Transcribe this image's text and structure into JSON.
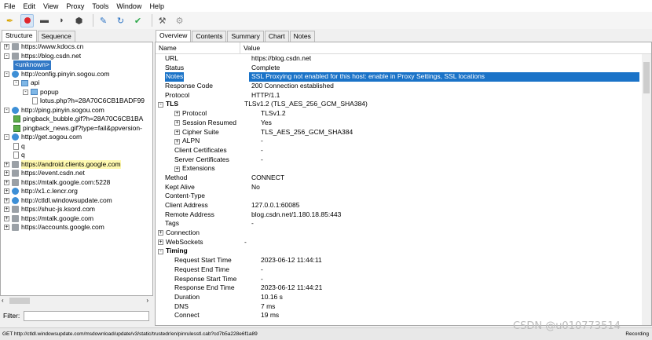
{
  "menu": [
    "File",
    "Edit",
    "View",
    "Proxy",
    "Tools",
    "Window",
    "Help"
  ],
  "left_tabs": [
    "Structure",
    "Sequence"
  ],
  "tree": [
    {
      "text": "https://www.kdocs.cn",
      "indent": 0,
      "exp": "+",
      "icon": "lock",
      "style": ""
    },
    {
      "text": "https://blog.csdn.net",
      "indent": 0,
      "exp": "-",
      "icon": "lock",
      "style": ""
    },
    {
      "text": "<unknown>",
      "indent": 1,
      "exp": "",
      "icon": "",
      "style": "sel"
    },
    {
      "text": "http://config.pinyin.sogou.com",
      "indent": 0,
      "exp": "-",
      "icon": "globe",
      "style": ""
    },
    {
      "text": "api",
      "indent": 1,
      "exp": "-",
      "icon": "folder",
      "style": ""
    },
    {
      "text": "popup",
      "indent": 2,
      "exp": "-",
      "icon": "folder",
      "style": ""
    },
    {
      "text": "lotus.php?h=28A70C6CB1BADF99",
      "indent": 3,
      "exp": "",
      "icon": "page",
      "style": ""
    },
    {
      "text": "http://ping.pinyin.sogou.com",
      "indent": 0,
      "exp": "-",
      "icon": "globe",
      "style": ""
    },
    {
      "text": "pingback_bubble.gif?h=28A70C6CB1BA",
      "indent": 1,
      "exp": "",
      "icon": "img",
      "style": ""
    },
    {
      "text": "pingback_news.gif?type=fail&ppversion-",
      "indent": 1,
      "exp": "",
      "icon": "img",
      "style": ""
    },
    {
      "text": "http://get.sogou.com",
      "indent": 0,
      "exp": "-",
      "icon": "globe",
      "style": ""
    },
    {
      "text": "q",
      "indent": 1,
      "exp": "",
      "icon": "page",
      "style": ""
    },
    {
      "text": "q",
      "indent": 1,
      "exp": "",
      "icon": "page",
      "style": ""
    },
    {
      "text": "https://android.clients.google.com",
      "indent": 0,
      "exp": "+",
      "icon": "lock",
      "style": "y"
    },
    {
      "text": "https://event.csdn.net",
      "indent": 0,
      "exp": "+",
      "icon": "lock",
      "style": ""
    },
    {
      "text": "https://mtalk.google.com:5228",
      "indent": 0,
      "exp": "+",
      "icon": "lock",
      "style": ""
    },
    {
      "text": "http://x1.c.lencr.org",
      "indent": 0,
      "exp": "+",
      "icon": "globe",
      "style": ""
    },
    {
      "text": "http://ctldl.windowsupdate.com",
      "indent": 0,
      "exp": "+",
      "icon": "globe",
      "style": ""
    },
    {
      "text": "https://shuc-js.ksord.com",
      "indent": 0,
      "exp": "+",
      "icon": "lock",
      "style": ""
    },
    {
      "text": "https://mtalk.google.com",
      "indent": 0,
      "exp": "+",
      "icon": "lock",
      "style": ""
    },
    {
      "text": "https://accounts.google.com",
      "indent": 0,
      "exp": "+",
      "icon": "lock",
      "style": ""
    }
  ],
  "filter": {
    "label": "Filter:",
    "value": ""
  },
  "right_tabs": [
    "Overview",
    "Contents",
    "Summary",
    "Chart",
    "Notes"
  ],
  "columns": [
    "Name",
    "Value"
  ],
  "rows": [
    {
      "name": "URL",
      "value": "https://blog.csdn.net",
      "indent": 1,
      "exp": "",
      "bold": false,
      "sel": false
    },
    {
      "name": "Status",
      "value": "Complete",
      "indent": 1,
      "exp": "",
      "bold": false,
      "sel": false
    },
    {
      "name": "Notes",
      "value": "SSL Proxying not enabled for this host: enable in Proxy Settings, SSL locations",
      "indent": 1,
      "exp": "",
      "bold": false,
      "sel": true
    },
    {
      "name": "Response Code",
      "value": "200 Connection established",
      "indent": 1,
      "exp": "",
      "bold": false,
      "sel": false
    },
    {
      "name": "Protocol",
      "value": "HTTP/1.1",
      "indent": 1,
      "exp": "",
      "bold": false,
      "sel": false
    },
    {
      "name": "TLS",
      "value": "TLSv1.2 (TLS_AES_256_GCM_SHA384)",
      "indent": 0,
      "exp": "-",
      "bold": true,
      "sel": false
    },
    {
      "name": "Protocol",
      "value": "TLSv1.2",
      "indent": 2,
      "exp": "+",
      "bold": false,
      "sel": false
    },
    {
      "name": "Session Resumed",
      "value": "Yes",
      "indent": 2,
      "exp": "+",
      "bold": false,
      "sel": false
    },
    {
      "name": "Cipher Suite",
      "value": "TLS_AES_256_GCM_SHA384",
      "indent": 2,
      "exp": "+",
      "bold": false,
      "sel": false
    },
    {
      "name": "ALPN",
      "value": "-",
      "indent": 2,
      "exp": "+",
      "bold": false,
      "sel": false
    },
    {
      "name": "Client Certificates",
      "value": "-",
      "indent": 3,
      "exp": "",
      "bold": false,
      "sel": false
    },
    {
      "name": "Server Certificates",
      "value": "-",
      "indent": 3,
      "exp": "",
      "bold": false,
      "sel": false
    },
    {
      "name": "Extensions",
      "value": "",
      "indent": 2,
      "exp": "+",
      "bold": false,
      "sel": false
    },
    {
      "name": "Method",
      "value": "CONNECT",
      "indent": 1,
      "exp": "",
      "bold": false,
      "sel": false
    },
    {
      "name": "Kept Alive",
      "value": "No",
      "indent": 1,
      "exp": "",
      "bold": false,
      "sel": false
    },
    {
      "name": "Content-Type",
      "value": "",
      "indent": 1,
      "exp": "",
      "bold": false,
      "sel": false
    },
    {
      "name": "Client Address",
      "value": "127.0.0.1:60085",
      "indent": 1,
      "exp": "",
      "bold": false,
      "sel": false
    },
    {
      "name": "Remote Address",
      "value": "blog.csdn.net/1.180.18.85:443",
      "indent": 1,
      "exp": "",
      "bold": false,
      "sel": false
    },
    {
      "name": "Tags",
      "value": "-",
      "indent": 1,
      "exp": "",
      "bold": false,
      "sel": false
    },
    {
      "name": "Connection",
      "value": "",
      "indent": 0,
      "exp": "+",
      "bold": false,
      "sel": false
    },
    {
      "name": "WebSockets",
      "value": "-",
      "indent": 0,
      "exp": "+",
      "bold": false,
      "sel": false
    },
    {
      "name": "Timing",
      "value": "",
      "indent": 0,
      "exp": "-",
      "bold": true,
      "sel": false
    },
    {
      "name": "Request Start Time",
      "value": "2023-06-12 11:44:11",
      "indent": 3,
      "exp": "",
      "bold": false,
      "sel": false
    },
    {
      "name": "Request End Time",
      "value": "-",
      "indent": 3,
      "exp": "",
      "bold": false,
      "sel": false
    },
    {
      "name": "Response Start Time",
      "value": "-",
      "indent": 3,
      "exp": "",
      "bold": false,
      "sel": false
    },
    {
      "name": "Response End Time",
      "value": "2023-06-12 11:44:21",
      "indent": 3,
      "exp": "",
      "bold": false,
      "sel": false
    },
    {
      "name": "Duration",
      "value": "10.16 s",
      "indent": 3,
      "exp": "",
      "bold": false,
      "sel": false
    },
    {
      "name": "DNS",
      "value": "7 ms",
      "indent": 3,
      "exp": "",
      "bold": false,
      "sel": false
    },
    {
      "name": "Connect",
      "value": "19 ms",
      "indent": 3,
      "exp": "",
      "bold": false,
      "sel": false
    }
  ],
  "status_text": "GET http://ctldl.windowsupdate.com/msdownload/update/v3/static/trustedr/en/pinrulesstl.cab?cd7b5a228e6f1a89",
  "status_right": "Recording",
  "watermark": "CSDN @u010773514"
}
